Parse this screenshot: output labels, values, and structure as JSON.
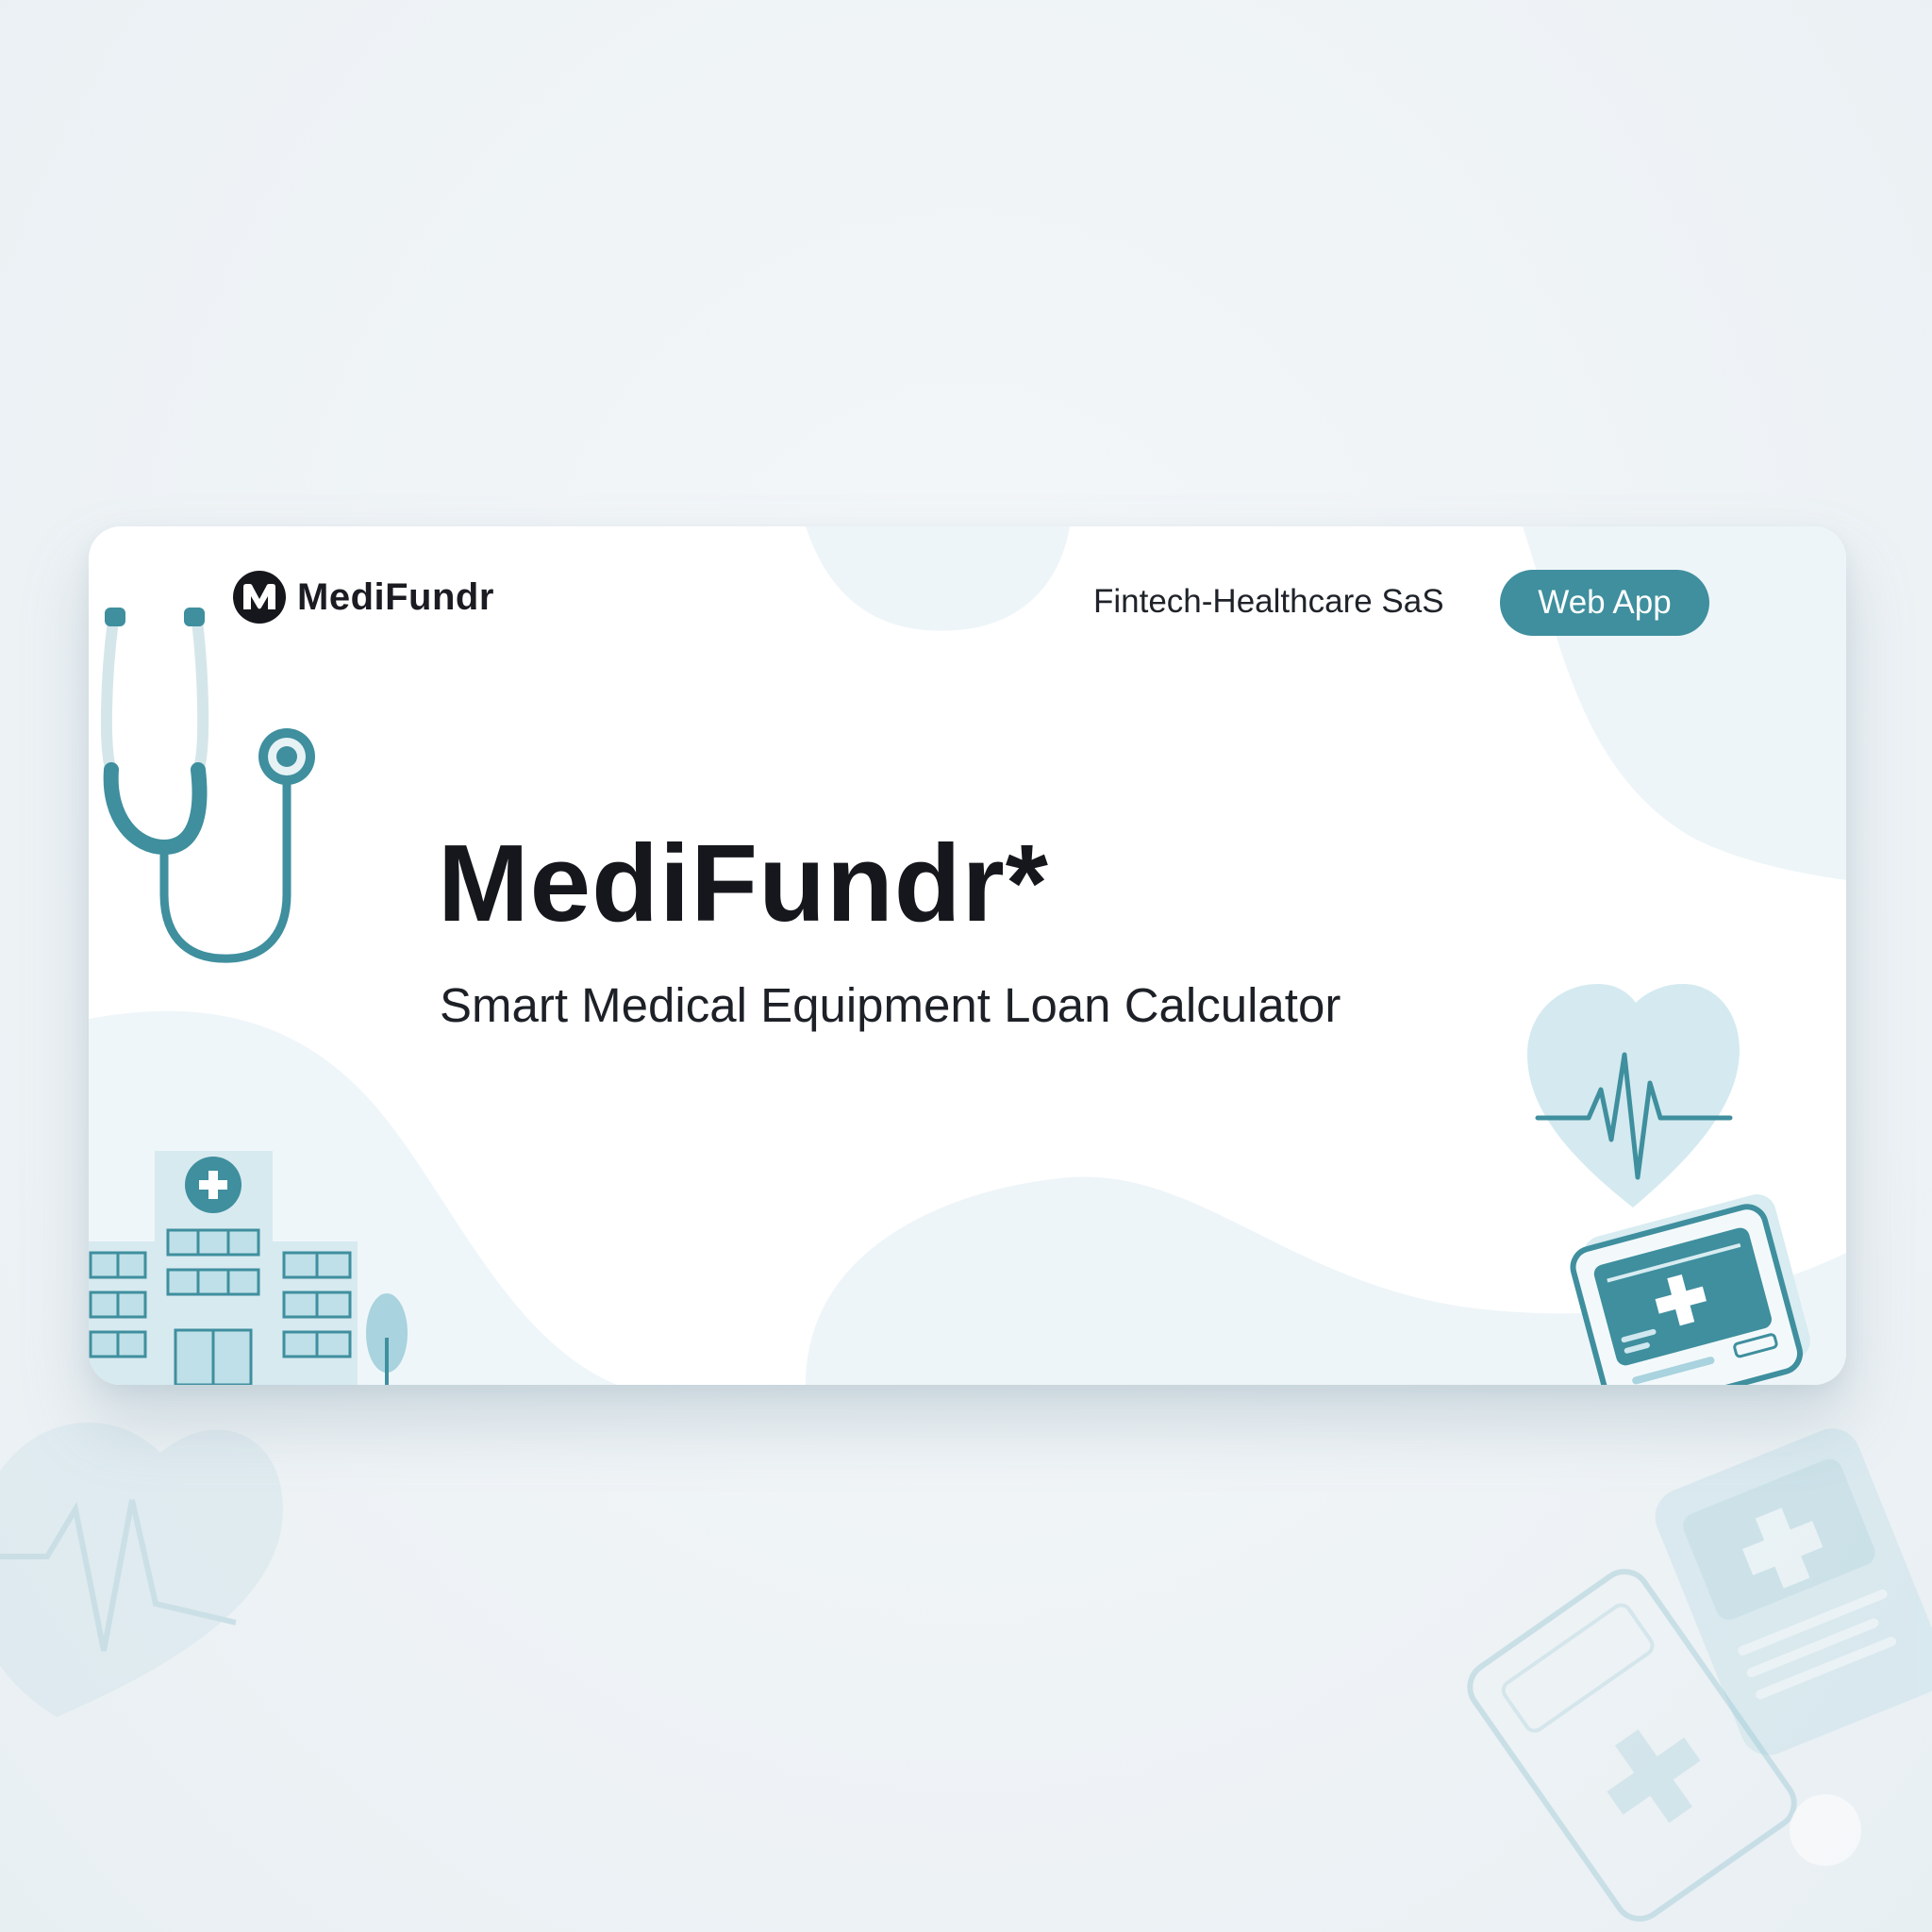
{
  "brand": {
    "name": "MediFundr",
    "mark_letter": "M"
  },
  "header": {
    "tagline": "Fintech-Healthcare SaS",
    "cta_label": "Web App"
  },
  "hero": {
    "title": "MediFundr*",
    "subtitle": "Smart Medical Equipment Loan Calculator"
  },
  "illustrations": [
    "stethoscope-icon",
    "hospital-building-icon",
    "tree-icon",
    "heart-pulse-icon",
    "medical-tablet-icon"
  ],
  "colors": {
    "accent": "#3f8f9e",
    "accent_light": "#a9d3de",
    "text_dark": "#15171c",
    "background": "#eef3f6"
  }
}
